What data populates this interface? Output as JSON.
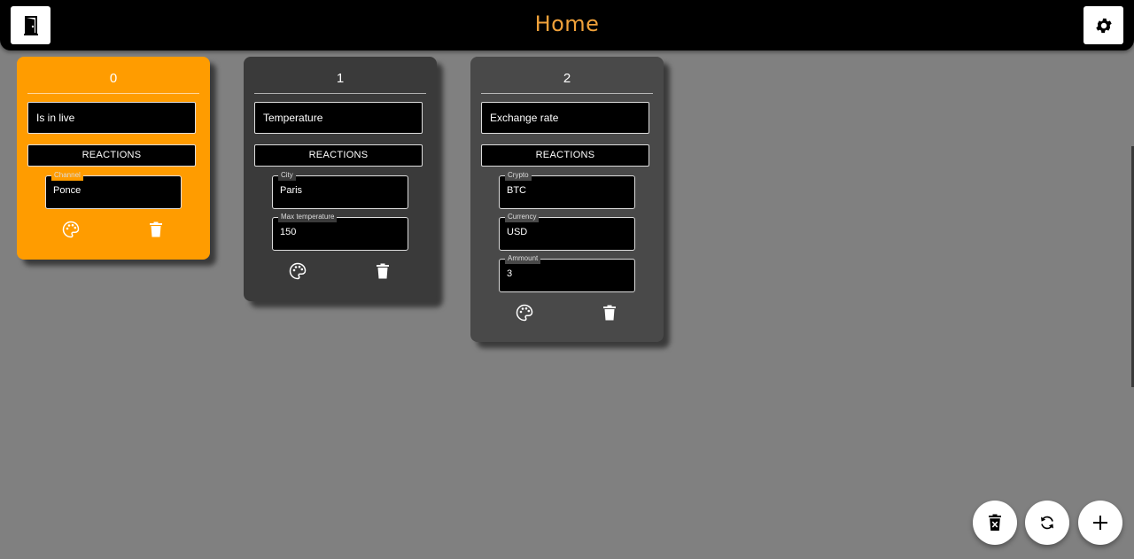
{
  "header": {
    "title": "Home",
    "title_color": "#f0a13a",
    "left_icon": "door-exit-icon",
    "right_icon": "gear-icon"
  },
  "cards": [
    {
      "index": "0",
      "background": "#ff9c00",
      "action": "Is in live",
      "reactions_label": "REACTIONS",
      "fields": [
        {
          "label": "Channel",
          "value": "Ponce"
        }
      ],
      "icons": [
        "palette-icon",
        "trash-icon"
      ]
    },
    {
      "index": "1",
      "background": "#3a3a3a",
      "action": "Temperature",
      "reactions_label": "REACTIONS",
      "fields": [
        {
          "label": "City",
          "value": "Paris"
        },
        {
          "label": "Max temperature",
          "value": "150"
        }
      ],
      "icons": [
        "palette-icon",
        "trash-icon"
      ]
    },
    {
      "index": "2",
      "background": "#494949",
      "action": "Exchange rate",
      "reactions_label": "REACTIONS",
      "fields": [
        {
          "label": "Crypto",
          "value": "BTC"
        },
        {
          "label": "Currency",
          "value": "USD"
        },
        {
          "label": "Ammount",
          "value": "3"
        }
      ],
      "icons": [
        "palette-icon",
        "trash-icon"
      ]
    }
  ],
  "fabs": [
    "delete-all-icon",
    "refresh-icon",
    "add-icon"
  ]
}
